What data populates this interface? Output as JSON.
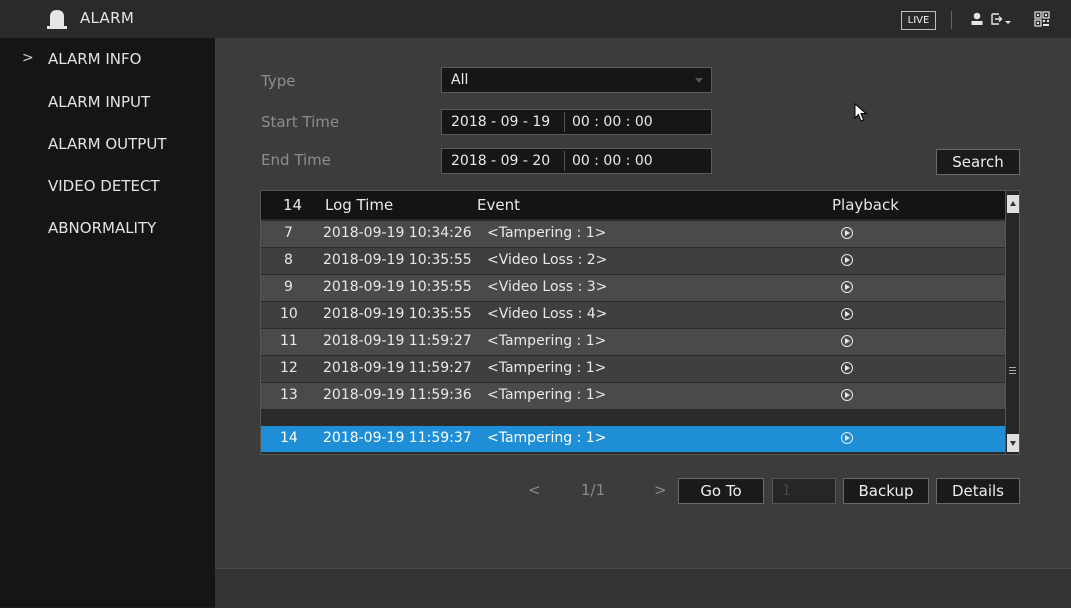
{
  "header": {
    "title": "ALARM",
    "live_label": "LIVE"
  },
  "sidebar": {
    "items": [
      {
        "label": "ALARM INFO",
        "active": true
      },
      {
        "label": "ALARM INPUT",
        "active": false
      },
      {
        "label": "ALARM OUTPUT",
        "active": false
      },
      {
        "label": "VIDEO DETECT",
        "active": false
      },
      {
        "label": "ABNORMALITY",
        "active": false
      }
    ],
    "active_marker": ">"
  },
  "filters": {
    "type_label": "Type",
    "type_value": "All",
    "start_label": "Start Time",
    "start_date": "2018 - 09 - 19",
    "start_time": "00 : 00 : 00",
    "end_label": "End Time",
    "end_date": "2018 - 09 - 20",
    "end_time": "00 : 00 : 00",
    "search_label": "Search"
  },
  "table": {
    "headers": {
      "count": "14",
      "log_time": "Log Time",
      "event": "Event",
      "playback": "Playback"
    },
    "rows": [
      {
        "no": "7",
        "time": "2018-09-19 10:34:26",
        "event": "<Tampering : 1>"
      },
      {
        "no": "8",
        "time": "2018-09-19 10:35:55",
        "event": "<Video Loss : 2>"
      },
      {
        "no": "9",
        "time": "2018-09-19 10:35:55",
        "event": "<Video Loss : 3>"
      },
      {
        "no": "10",
        "time": "2018-09-19 10:35:55",
        "event": "<Video Loss : 4>"
      },
      {
        "no": "11",
        "time": "2018-09-19 11:59:27",
        "event": "<Tampering : 1>"
      },
      {
        "no": "12",
        "time": "2018-09-19 11:59:27",
        "event": "<Tampering : 1>"
      },
      {
        "no": "13",
        "time": "2018-09-19 11:59:36",
        "event": "<Tampering : 1>"
      },
      {
        "no": "14",
        "time": "2018-09-19 11:59:37",
        "event": "<Tampering : 1>"
      }
    ],
    "selected_no": "14"
  },
  "pager": {
    "prev": "<",
    "page": "1/1",
    "next": ">",
    "goto_label": "Go To",
    "goto_value": "1",
    "backup_label": "Backup",
    "details_label": "Details"
  },
  "colors": {
    "selection": "#1e8fd6",
    "background": "#3c3c3c"
  }
}
